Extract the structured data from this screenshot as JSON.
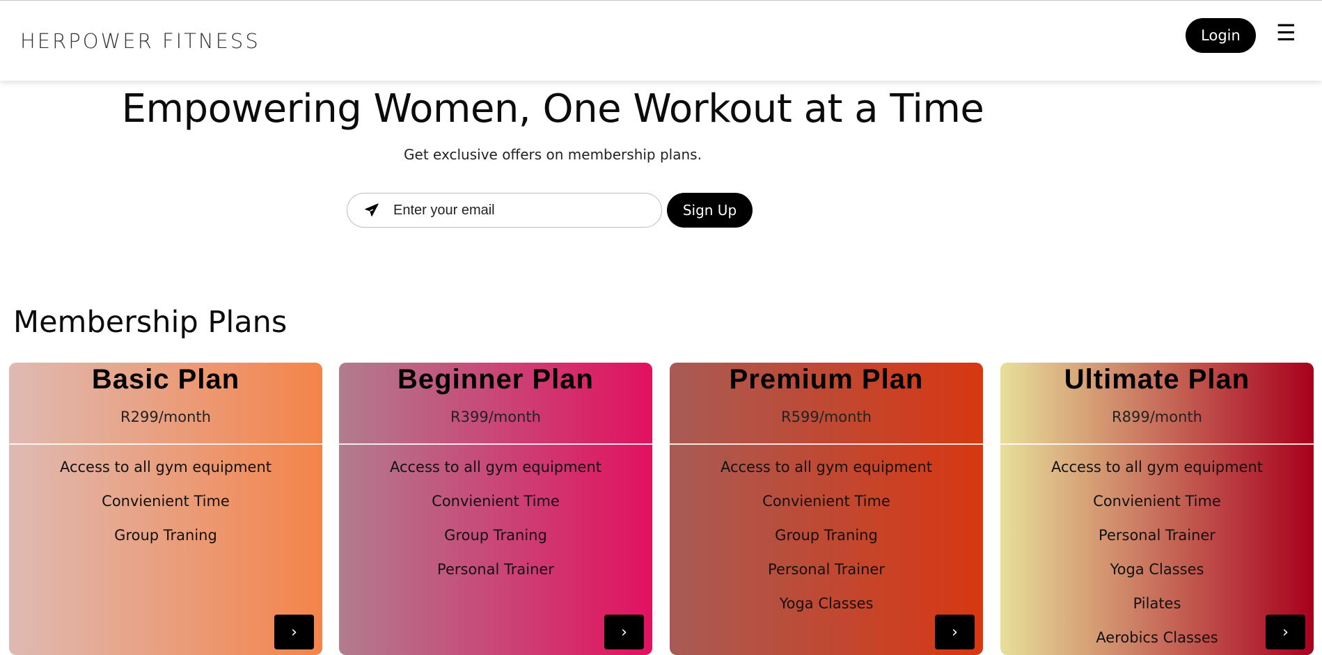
{
  "header": {
    "brand": "HERPOWER FITNESS",
    "login_label": "Login",
    "menu_icon": "hamburger-menu-icon"
  },
  "hero": {
    "title": "Empowering Women, One Workout at a Time",
    "subtitle": "Get exclusive offers on membership plans.",
    "email_placeholder": "Enter your email",
    "email_icon": "paper-plane-icon",
    "signup_label": "Sign Up"
  },
  "plans": {
    "title": "Membership Plans",
    "items": [
      {
        "name": "Basic Plan",
        "price": "R299/month",
        "features": [
          "Access to all gym equipment",
          "Convienient Time",
          "Group Traning"
        ],
        "gradient": [
          "#dfbab3",
          "#f4844a"
        ]
      },
      {
        "name": "Beginner Plan",
        "price": "R399/month",
        "features": [
          "Access to all gym equipment",
          "Convienient Time",
          "Group Traning",
          "Personal Trainer"
        ],
        "gradient": [
          "#b17c8e",
          "#e2115f"
        ]
      },
      {
        "name": "Premium Plan",
        "price": "R599/month",
        "features": [
          "Access to all gym equipment",
          "Convienient Time",
          "Group Traning",
          "Personal Trainer",
          "Yoga Classes"
        ],
        "gradient": [
          "#a85b55",
          "#d73711"
        ]
      },
      {
        "name": "Ultimate Plan",
        "price": "R899/month",
        "features": [
          "Access to all gym equipment",
          "Convienient Time",
          "Personal Trainer",
          "Yoga Classes",
          "Pilates",
          "Aerobics Classes"
        ],
        "gradient": [
          "#e8df99",
          "#a8001e"
        ]
      }
    ],
    "arrow_icon": "chevron-right-icon"
  }
}
